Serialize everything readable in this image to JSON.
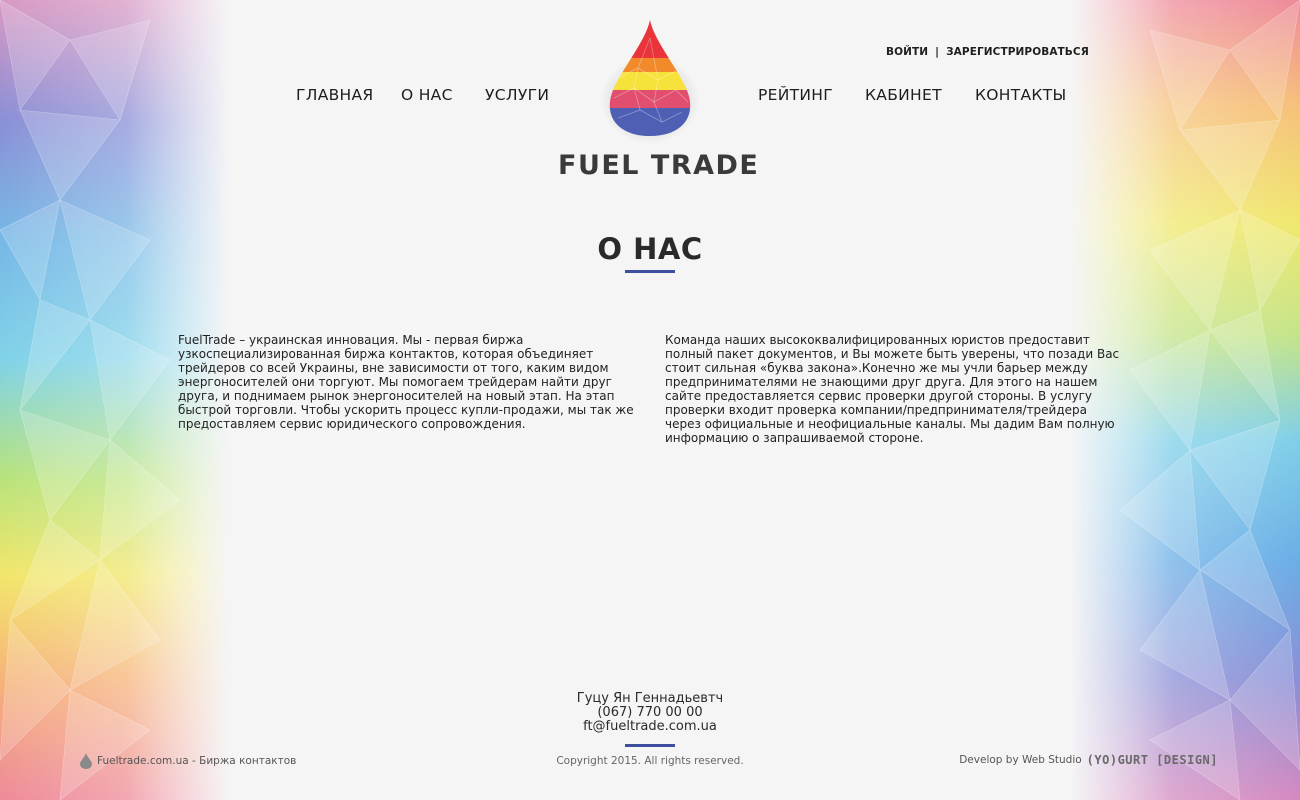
{
  "auth": {
    "login": "ВОЙТИ",
    "separator": "|",
    "register": "ЗАРЕГИСТРИРОВАТЬСЯ"
  },
  "nav": {
    "left": [
      "ГЛАВНАЯ",
      "О НАС",
      "УСЛУГИ"
    ],
    "right": [
      "РЕЙТИНГ",
      "КАБИНЕТ",
      "КОНТАКТЫ"
    ]
  },
  "logo": {
    "text": "FUEL TRADE"
  },
  "section": {
    "title": "О НАС"
  },
  "content": {
    "left": "FuelTrade – украинская инновация. Мы - первая биржа узкоспециализированная биржа контактов, которая объединяет трейдеров со всей Украины, вне зависимости от того, каким видом энергоносителей они торгуют. Мы помогаем трейдерам найти друг друга, и поднимаем рынок энергоносителей на новый этап. На этап быстрой торговли. Чтобы ускорить процесс купли-продажи, мы так же предоставляем сервис юридического сопровождения.",
    "right": "Команда наших высококвалифицированных юристов предоставит полный пакет документов, и Вы можете быть уверены, что позади Вас стоит сильная «буква закона».Конечно же мы учли барьер между предпринимателями не знающими друг друга. Для этого на нашем сайте предоставляется сервис проверки другой стороны. В услугу проверки входит проверка компании/предпринимателя/трейдера через официальные и неофициальные каналы. Мы дадим Вам полную информацию о запрашиваемой стороне."
  },
  "contact": {
    "name": "Гуцу Ян Геннадьевтч",
    "phone": "(067) 770 00 00",
    "email": "ft@fueltrade.com.ua"
  },
  "footer": {
    "left": "Fueltrade.com.ua - Биржа контактов",
    "center": "Copyright 2015. All rights reserved.",
    "right_prefix": "Develop by Web Studio",
    "right_brand": "(YO)GURT [DESIGN]"
  },
  "colors": {
    "accent": "#3f4fa0",
    "text": "#2b2b2b",
    "background": "#f5f5f6"
  }
}
